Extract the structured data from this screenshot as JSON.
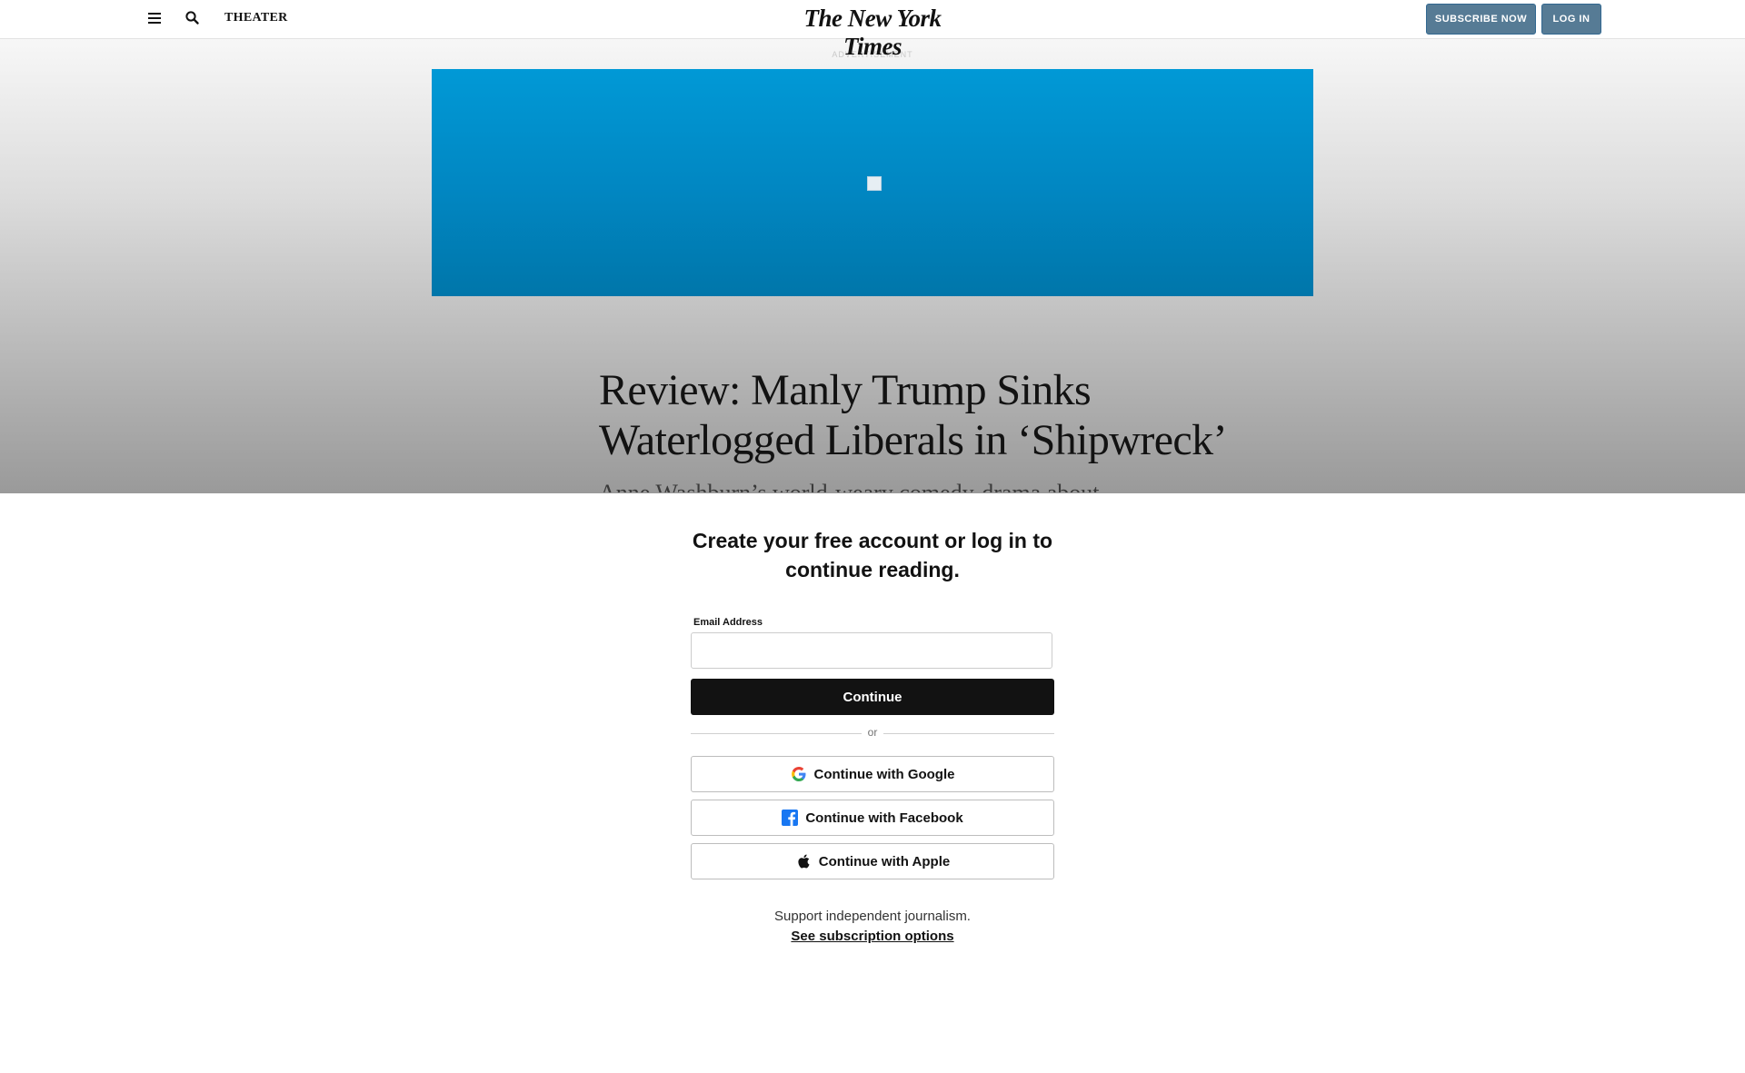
{
  "header": {
    "section": "THEATER",
    "logo_text": "The New York Times",
    "subscribe_label": "SUBSCRIBE NOW",
    "login_label": "LOG IN"
  },
  "advertisement": {
    "label": "ADVERTISEMENT"
  },
  "article": {
    "headline_line1": "Review: Manly Trump Sinks",
    "headline_line2": "Waterlogged Liberals in ‘Shipwreck’",
    "summary_partial": "Anne Washburn’s world-weary comedy-drama about"
  },
  "login": {
    "title_line1": "Create your free account or log in to",
    "title_line2": "continue reading.",
    "email_label": "Email Address",
    "email_value": "",
    "continue_label": "Continue",
    "or_text": "or",
    "google_label": "Continue with Google",
    "facebook_label": "Continue with Facebook",
    "apple_label": "Continue with Apple",
    "support_text": "Support independent journalism.",
    "subscription_link": "See subscription options"
  },
  "icons": {
    "menu": "menu-icon",
    "search": "search-icon",
    "google": "google-icon",
    "facebook": "facebook-icon",
    "apple": "apple-icon"
  },
  "colors": {
    "header_button": "#567b95",
    "ad_banner": "#0190cc",
    "continue_button": "#121212",
    "facebook": "#1877f2"
  }
}
